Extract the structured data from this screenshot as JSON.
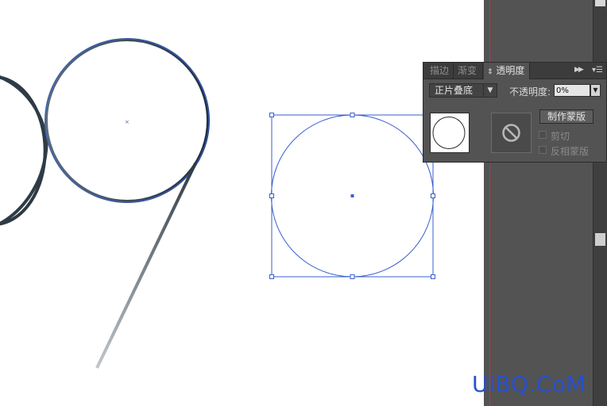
{
  "panel": {
    "tabs": [
      "描边",
      "渐变",
      "透明度"
    ],
    "blend_mode": "正片叠底",
    "opacity_label": "不透明度:",
    "opacity_value": "0%",
    "make_mask_label": "制作蒙版",
    "clip_label": "剪切",
    "clip_checked": false,
    "invert_label": "反相蒙版",
    "invert_checked": false
  },
  "watermark": "UiBQ.CoM",
  "colors": {
    "selection": "#3a5fcd",
    "panel_bg": "#535353",
    "workspace": "#535353",
    "guide": "#c8313a",
    "watermark": "#2550cf"
  }
}
